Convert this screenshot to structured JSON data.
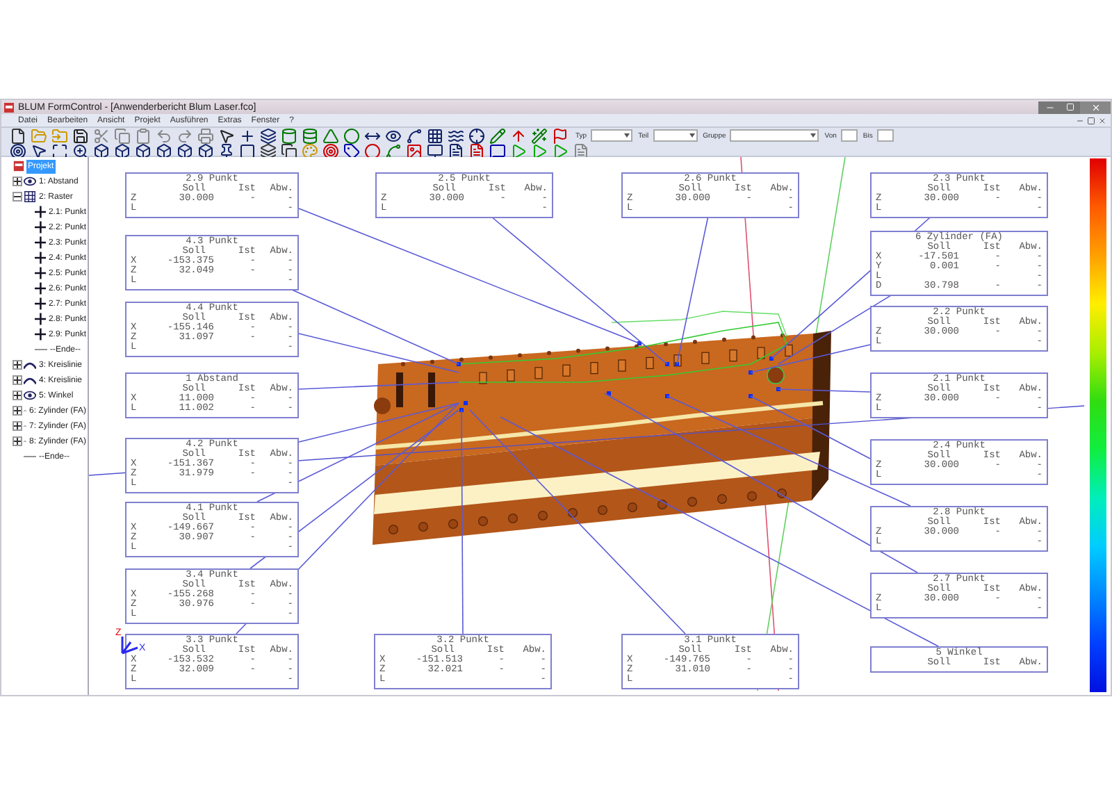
{
  "window": {
    "title": "BLUM FormControl - [Anwenderbericht Blum Laser.fco]"
  },
  "menu": [
    "Datei",
    "Bearbeiten",
    "Ansicht",
    "Projekt",
    "Ausführen",
    "Extras",
    "Fenster",
    "?"
  ],
  "filters": [
    {
      "label": "Typ",
      "kind": "select"
    },
    {
      "label": "Teil",
      "kind": "select"
    },
    {
      "label": "Gruppe",
      "kind": "select"
    },
    {
      "label": "Von",
      "kind": "text"
    },
    {
      "label": "Bis",
      "kind": "text"
    }
  ],
  "tree": {
    "label": "Projekt",
    "kind": "project",
    "selected": true,
    "children": [
      {
        "label": "1: Abstand",
        "kind": "distance",
        "expanded": false
      },
      {
        "label": "2: Raster",
        "kind": "grid",
        "expanded": true,
        "children": [
          {
            "label": "2.1: Punkt",
            "kind": "point"
          },
          {
            "label": "2.2: Punkt",
            "kind": "point"
          },
          {
            "label": "2.3: Punkt",
            "kind": "point"
          },
          {
            "label": "2.4: Punkt",
            "kind": "point"
          },
          {
            "label": "2.5: Punkt",
            "kind": "point"
          },
          {
            "label": "2.6: Punkt",
            "kind": "point"
          },
          {
            "label": "2.7: Punkt",
            "kind": "point"
          },
          {
            "label": "2.8: Punkt",
            "kind": "point"
          },
          {
            "label": "2.9: Punkt",
            "kind": "point"
          },
          {
            "label": "--Ende--",
            "kind": "end"
          }
        ]
      },
      {
        "label": "3: Kreislinie",
        "kind": "arc",
        "expanded": false
      },
      {
        "label": "4: Kreislinie",
        "kind": "arc",
        "expanded": false
      },
      {
        "label": "5: Winkel",
        "kind": "distance",
        "expanded": false
      },
      {
        "label": "6: Zylinder (FA)",
        "kind": "arc",
        "expanded": false
      },
      {
        "label": "7: Zylinder (FA)",
        "kind": "arc",
        "expanded": false
      },
      {
        "label": "8: Zylinder (FA)",
        "kind": "arc",
        "expanded": false
      },
      {
        "label": "--Ende--",
        "kind": "end"
      }
    ]
  },
  "axis_triad": {
    "z": "Z",
    "x": "X"
  },
  "labels": [
    {
      "title": "2.9 Punkt",
      "header": [
        "Soll",
        "Ist",
        "Abw."
      ],
      "rows": [
        {
          "axis": "Z",
          "soll": "30.000",
          "ist": "-",
          "abw": "-"
        },
        {
          "axis": "L",
          "abw": "-"
        }
      ]
    },
    {
      "title": "2.5 Punkt",
      "header": [
        "Soll",
        "Ist",
        "Abw."
      ],
      "rows": [
        {
          "axis": "Z",
          "soll": "30.000",
          "ist": "-",
          "abw": "-"
        },
        {
          "axis": "L",
          "abw": "-"
        }
      ]
    },
    {
      "title": "2.6 Punkt",
      "header": [
        "Soll",
        "Ist",
        "Abw."
      ],
      "rows": [
        {
          "axis": "Z",
          "soll": "30.000",
          "ist": "-",
          "abw": "-"
        },
        {
          "axis": "L",
          "abw": "-"
        }
      ]
    },
    {
      "title": "2.3 Punkt",
      "header": [
        "Soll",
        "Ist",
        "Abw."
      ],
      "rows": [
        {
          "axis": "Z",
          "soll": "30.000",
          "ist": "-",
          "abw": "-"
        },
        {
          "axis": "L",
          "abw": "-"
        }
      ]
    },
    {
      "title": "4.3 Punkt",
      "header": [
        "Soll",
        "Ist",
        "Abw."
      ],
      "rows": [
        {
          "axis": "X",
          "soll": "-153.375",
          "ist": "-",
          "abw": "-"
        },
        {
          "axis": "Z",
          "soll": "32.049",
          "ist": "-",
          "abw": "-"
        },
        {
          "axis": "L",
          "abw": "-"
        }
      ]
    },
    {
      "title": "6 Zylinder (FA)",
      "header": [
        "Soll",
        "Ist",
        "Abw."
      ],
      "rows": [
        {
          "axis": "X",
          "soll": "-17.501",
          "ist": "-",
          "abw": "-"
        },
        {
          "axis": "Y",
          "soll": "0.001",
          "ist": "-",
          "abw": "-"
        },
        {
          "axis": "L",
          "abw": "-"
        },
        {
          "axis": "D",
          "soll": "30.798",
          "ist": "-",
          "abw": "-"
        }
      ]
    },
    {
      "title": "4.4 Punkt",
      "header": [
        "Soll",
        "Ist",
        "Abw."
      ],
      "rows": [
        {
          "axis": "X",
          "soll": "-155.146",
          "ist": "-",
          "abw": "-"
        },
        {
          "axis": "Z",
          "soll": "31.097",
          "ist": "-",
          "abw": "-"
        },
        {
          "axis": "L",
          "abw": "-"
        }
      ]
    },
    {
      "title": "2.2 Punkt",
      "header": [
        "Soll",
        "Ist",
        "Abw."
      ],
      "rows": [
        {
          "axis": "Z",
          "soll": "30.000",
          "ist": "-",
          "abw": "-"
        },
        {
          "axis": "L",
          "abw": "-"
        }
      ]
    },
    {
      "title": "1 Abstand",
      "header": [
        "Soll",
        "Ist",
        "Abw."
      ],
      "rows": [
        {
          "axis": "X",
          "soll": "11.000",
          "ist": "-",
          "abw": "-"
        },
        {
          "axis": "L",
          "soll": "11.002",
          "ist": "-",
          "abw": "-"
        }
      ]
    },
    {
      "title": "2.1 Punkt",
      "header": [
        "Soll",
        "Ist",
        "Abw."
      ],
      "rows": [
        {
          "axis": "Z",
          "soll": "30.000",
          "ist": "-",
          "abw": "-"
        },
        {
          "axis": "L",
          "abw": "-"
        }
      ]
    },
    {
      "title": "4.2 Punkt",
      "header": [
        "Soll",
        "Ist",
        "Abw."
      ],
      "rows": [
        {
          "axis": "X",
          "soll": "-151.367",
          "ist": "-",
          "abw": "-"
        },
        {
          "axis": "Z",
          "soll": "31.979",
          "ist": "-",
          "abw": "-"
        },
        {
          "axis": "L",
          "abw": "-"
        }
      ]
    },
    {
      "title": "2.4 Punkt",
      "header": [
        "Soll",
        "Ist",
        "Abw."
      ],
      "rows": [
        {
          "axis": "Z",
          "soll": "30.000",
          "ist": "-",
          "abw": "-"
        },
        {
          "axis": "L",
          "abw": "-"
        }
      ]
    },
    {
      "title": "4.1 Punkt",
      "header": [
        "Soll",
        "Ist",
        "Abw."
      ],
      "rows": [
        {
          "axis": "X",
          "soll": "-149.667",
          "ist": "-",
          "abw": "-"
        },
        {
          "axis": "Z",
          "soll": "30.907",
          "ist": "-",
          "abw": "-"
        },
        {
          "axis": "L",
          "abw": "-"
        }
      ]
    },
    {
      "title": "2.8 Punkt",
      "header": [
        "Soll",
        "Ist",
        "Abw."
      ],
      "rows": [
        {
          "axis": "Z",
          "soll": "30.000",
          "ist": "-",
          "abw": "-"
        },
        {
          "axis": "L",
          "abw": "-"
        }
      ]
    },
    {
      "title": "3.4 Punkt",
      "header": [
        "Soll",
        "Ist",
        "Abw."
      ],
      "rows": [
        {
          "axis": "X",
          "soll": "-155.268",
          "ist": "-",
          "abw": "-"
        },
        {
          "axis": "Z",
          "soll": "30.976",
          "ist": "-",
          "abw": "-"
        },
        {
          "axis": "L",
          "abw": "-"
        }
      ]
    },
    {
      "title": "2.7 Punkt",
      "header": [
        "Soll",
        "Ist",
        "Abw."
      ],
      "rows": [
        {
          "axis": "Z",
          "soll": "30.000",
          "ist": "-",
          "abw": "-"
        },
        {
          "axis": "L",
          "abw": "-"
        }
      ]
    },
    {
      "title": "3.3 Punkt",
      "header": [
        "Soll",
        "Ist",
        "Abw."
      ],
      "rows": [
        {
          "axis": "X",
          "soll": "-153.532",
          "ist": "-",
          "abw": "-"
        },
        {
          "axis": "Z",
          "soll": "32.009",
          "ist": "-",
          "abw": "-"
        },
        {
          "axis": "L",
          "abw": "-"
        }
      ]
    },
    {
      "title": "3.2 Punkt",
      "header": [
        "Soll",
        "Ist",
        "Abw."
      ],
      "rows": [
        {
          "axis": "X",
          "soll": "-151.513",
          "ist": "-",
          "abw": "-"
        },
        {
          "axis": "Z",
          "soll": "32.021",
          "ist": "-",
          "abw": "-"
        },
        {
          "axis": "L",
          "abw": "-"
        }
      ]
    },
    {
      "title": "3.1 Punkt",
      "header": [
        "Soll",
        "Ist",
        "Abw."
      ],
      "rows": [
        {
          "axis": "X",
          "soll": "-149.765",
          "ist": "-",
          "abw": "-"
        },
        {
          "axis": "Z",
          "soll": "31.010",
          "ist": "-",
          "abw": "-"
        },
        {
          "axis": "L",
          "abw": "-"
        }
      ]
    },
    {
      "title": "5 Winkel",
      "header": [
        "Soll",
        "Ist",
        "Abw."
      ]
    }
  ]
}
